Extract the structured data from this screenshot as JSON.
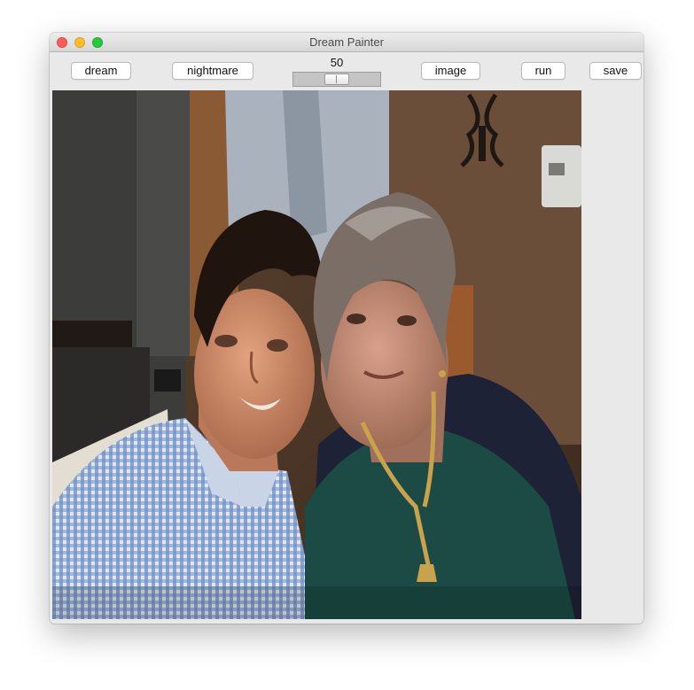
{
  "window": {
    "title": "Dream Painter"
  },
  "toolbar": {
    "buttons": [
      {
        "id": "dream",
        "label": "dream"
      },
      {
        "id": "nightmare",
        "label": "nightmare"
      },
      {
        "id": "image",
        "label": "image"
      },
      {
        "id": "run",
        "label": "run"
      },
      {
        "id": "save",
        "label": "save"
      }
    ],
    "slider": {
      "value_label": "50",
      "value": 50,
      "min": 0,
      "max": 100
    }
  },
  "photo": {
    "subject": "portrait of a young man and an elderly woman"
  }
}
